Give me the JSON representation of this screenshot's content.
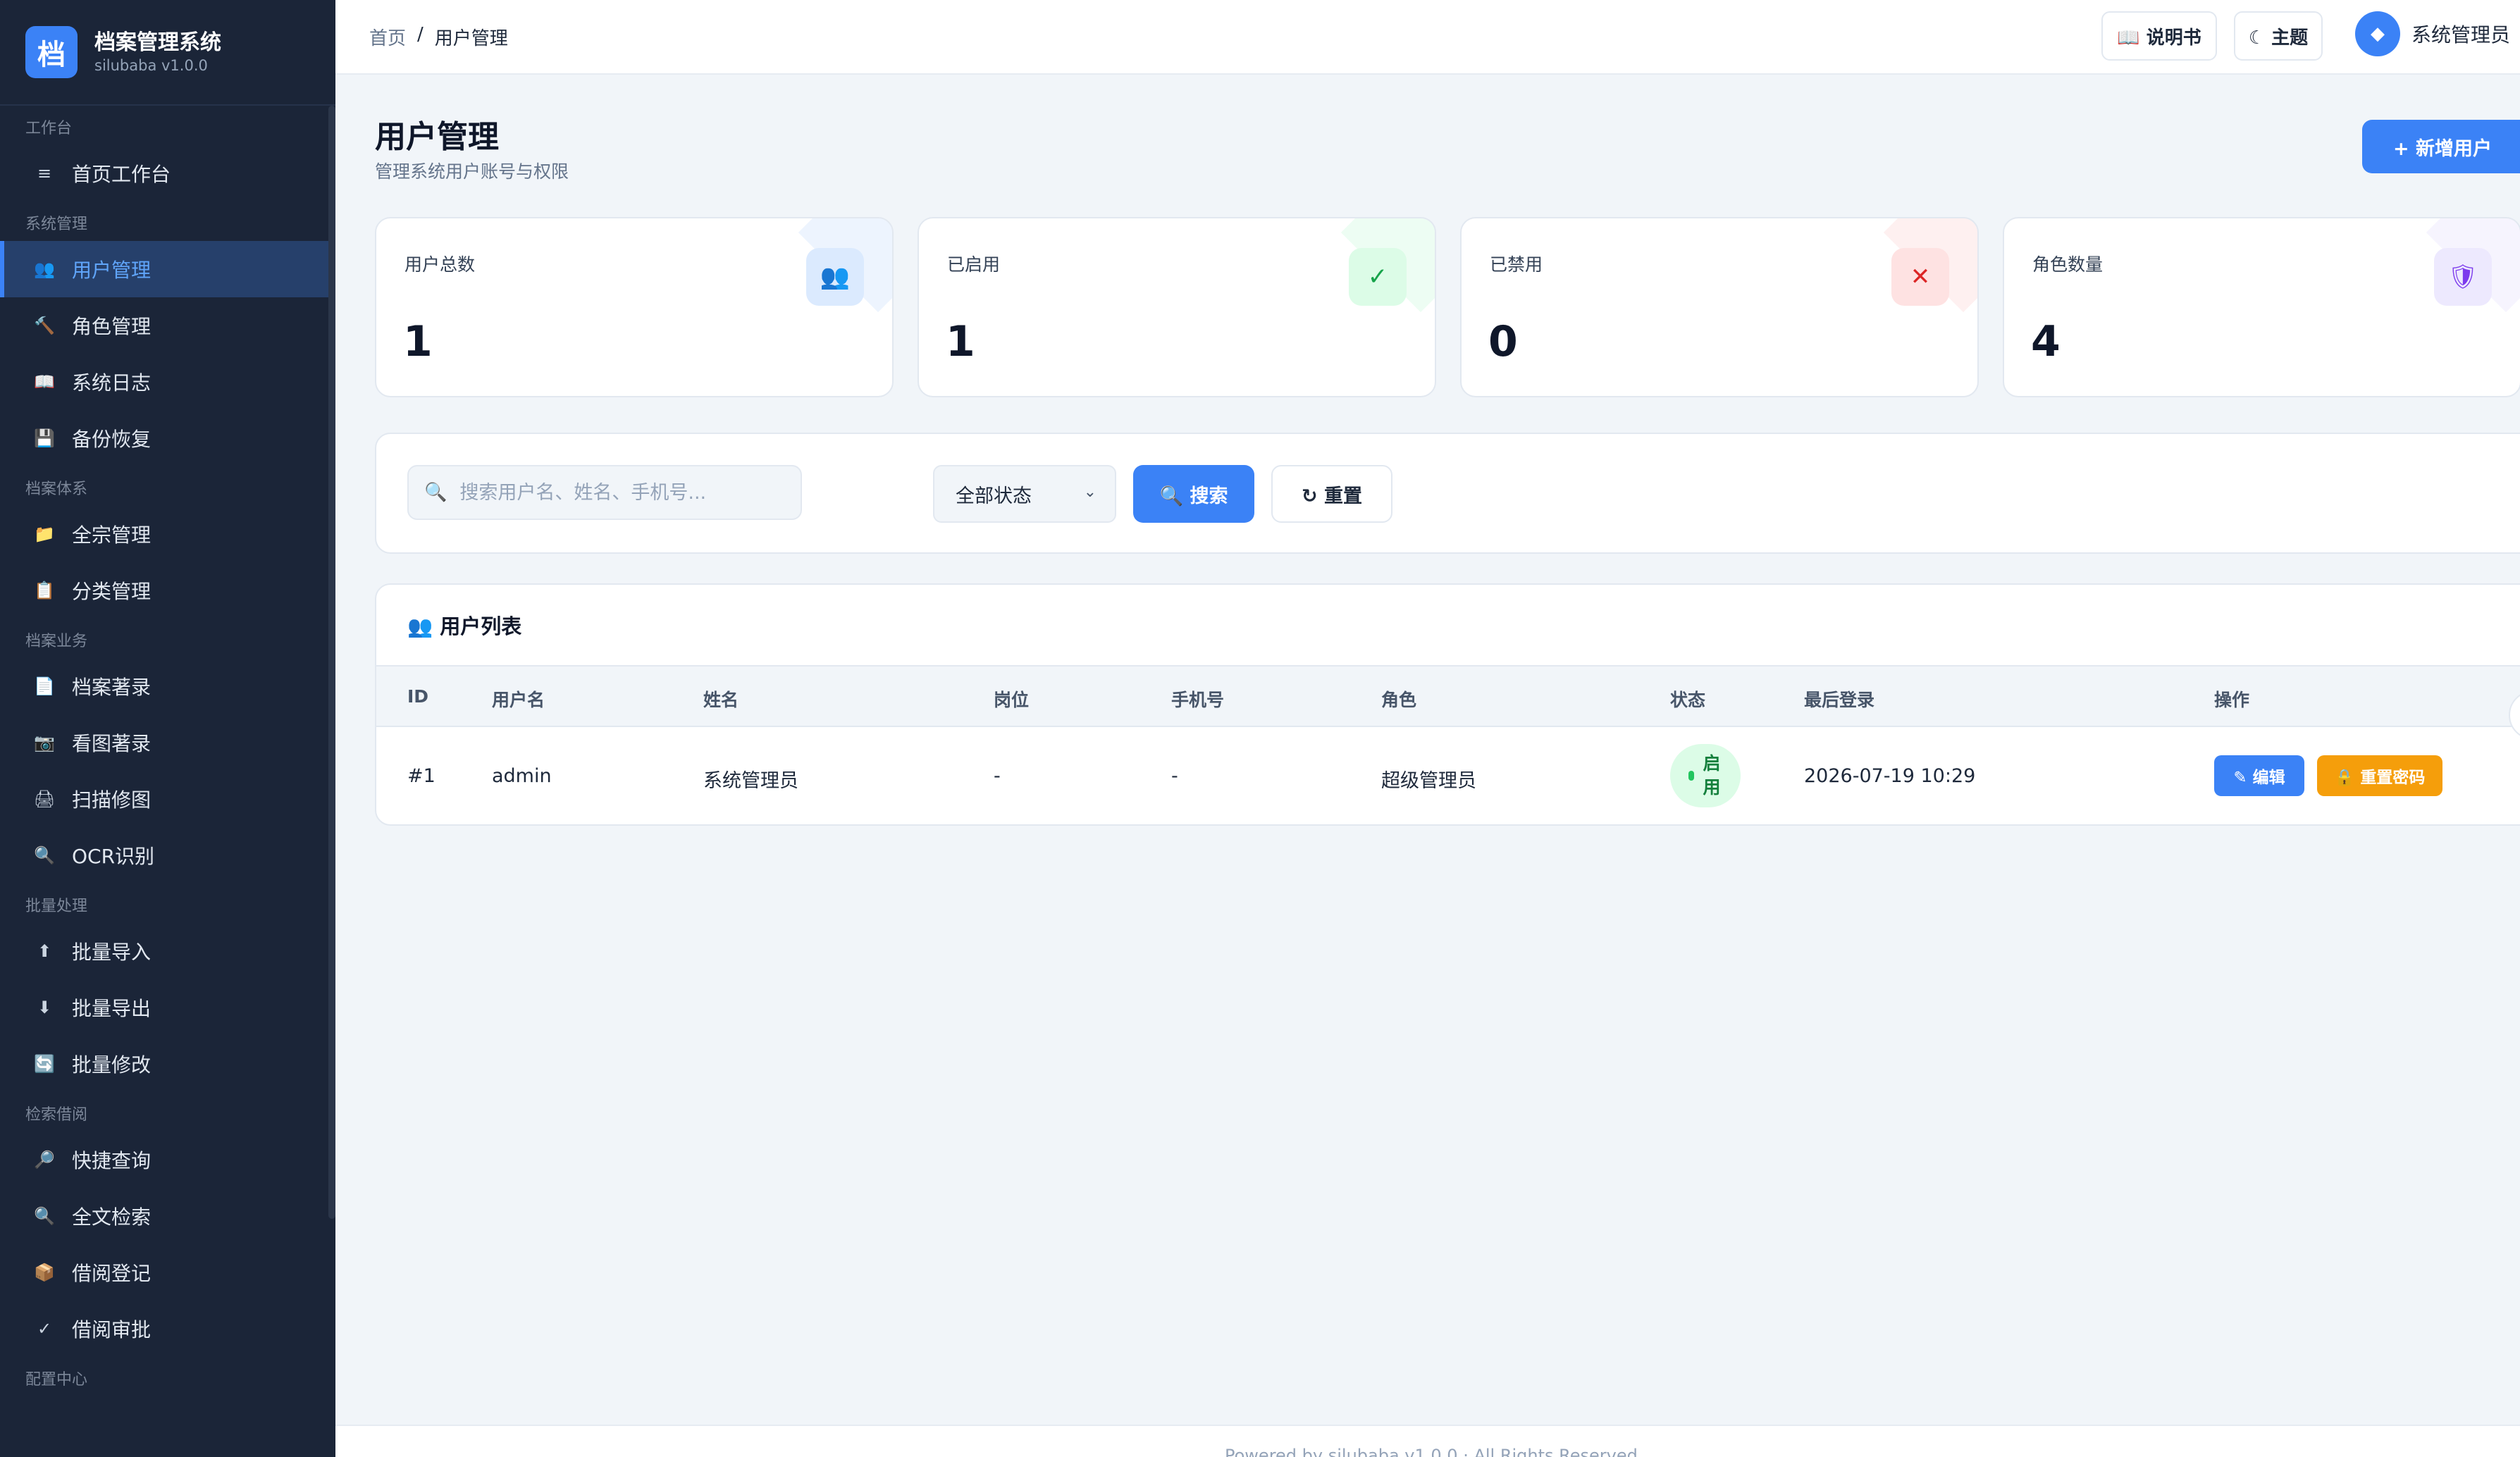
{
  "brand": {
    "logo_char": "档",
    "title": "档案管理系统",
    "version": "silubaba v1.0.0"
  },
  "sidebar": {
    "sections": [
      {
        "title": "工作台",
        "items": [
          {
            "label": "首页工作台",
            "icon": "≡"
          }
        ]
      },
      {
        "title": "系统管理",
        "items": [
          {
            "label": "用户管理",
            "icon": "👥",
            "active": true
          },
          {
            "label": "角色管理",
            "icon": "🔨"
          },
          {
            "label": "系统日志",
            "icon": "📖"
          },
          {
            "label": "备份恢复",
            "icon": "💾"
          }
        ]
      },
      {
        "title": "档案体系",
        "items": [
          {
            "label": "全宗管理",
            "icon": "📁"
          },
          {
            "label": "分类管理",
            "icon": "📋"
          }
        ]
      },
      {
        "title": "档案业务",
        "items": [
          {
            "label": "档案著录",
            "icon": "📄"
          },
          {
            "label": "看图著录",
            "icon": "📷"
          },
          {
            "label": "扫描修图",
            "icon": "🖨"
          },
          {
            "label": "OCR识别",
            "icon": "🔍"
          }
        ]
      },
      {
        "title": "批量处理",
        "items": [
          {
            "label": "批量导入",
            "icon": "⬆"
          },
          {
            "label": "批量导出",
            "icon": "⬇"
          },
          {
            "label": "批量修改",
            "icon": "🔄"
          }
        ]
      },
      {
        "title": "检索借阅",
        "items": [
          {
            "label": "快捷查询",
            "icon": "🔎"
          },
          {
            "label": "全文检索",
            "icon": "🔍"
          },
          {
            "label": "借阅登记",
            "icon": "📦"
          },
          {
            "label": "借阅审批",
            "icon": "✓"
          }
        ]
      },
      {
        "title": "配置中心",
        "items": []
      }
    ]
  },
  "header": {
    "breadcrumb": {
      "home": "首页",
      "separator": "/",
      "current": "用户管理"
    },
    "manual_label": "📖 说明书",
    "theme_label": "☾ 主题",
    "user_icon": "◆",
    "user_name": "系统管理员"
  },
  "page": {
    "title": "用户管理",
    "subtitle": "管理系统用户账号与权限",
    "add_button": "+ 新增用户"
  },
  "stats": [
    {
      "label": "用户总数",
      "value": "1",
      "icon": "👥",
      "color": "#dbeafe",
      "accent": "#3b82f6"
    },
    {
      "label": "已启用",
      "value": "1",
      "icon": "✓",
      "color": "#dcfce7",
      "accent": "#16a34a"
    },
    {
      "label": "已禁用",
      "value": "0",
      "icon": "✕",
      "color": "#fee2e2",
      "accent": "#dc2626"
    },
    {
      "label": "角色数量",
      "value": "4",
      "icon": "🛡",
      "color": "#ede9fe",
      "accent": "#7c3aed"
    }
  ],
  "filter": {
    "search_icon": "🔍",
    "search_placeholder": "搜索用户名、姓名、手机号...",
    "status_selected": "全部状态",
    "search_button": "🔍 搜索",
    "reset_button": "↻ 重置"
  },
  "table": {
    "title": "👥 用户列表",
    "columns": [
      "ID",
      "用户名",
      "姓名",
      "岗位",
      "手机号",
      "角色",
      "状态",
      "最后登录",
      "操作"
    ],
    "rows": [
      {
        "id": "#1",
        "username": "admin",
        "name": "系统管理员",
        "position": "-",
        "phone": "-",
        "role": "超级管理员",
        "status": "启用",
        "last_login": "2026-07-19 10:29",
        "edit": "✎ 编辑",
        "reset_pwd": "🔒 重置密码"
      }
    ]
  },
  "footer": {
    "text": "Powered by silubaba v1.0.0 · All Rights Reserved"
  }
}
